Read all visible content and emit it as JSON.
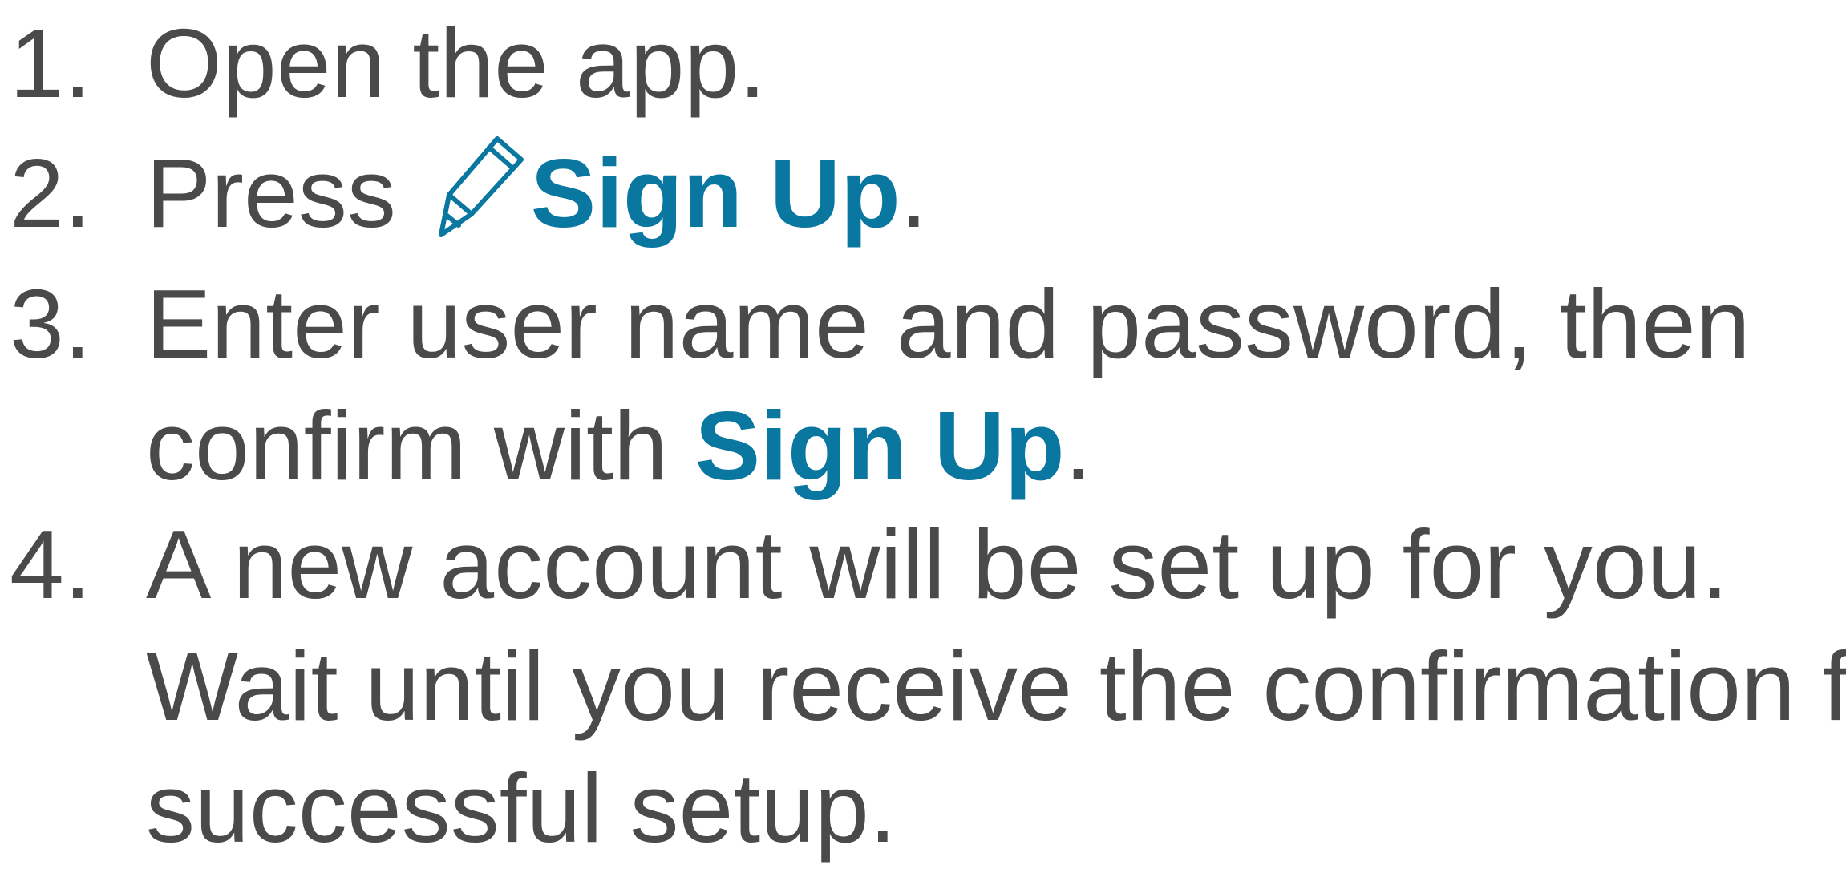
{
  "colors": {
    "text": "#4a4a4a",
    "accent": "#0a77a0",
    "background": "#ffffff"
  },
  "steps": [
    {
      "number": "1.",
      "text": "Open the app."
    },
    {
      "number": "2.",
      "prefix": "Press",
      "icon": "pencil-icon",
      "link": "Sign Up",
      "suffix": "."
    },
    {
      "number": "3.",
      "line1": "Enter user name and password, then",
      "line2_prefix": "confirm with",
      "link": "Sign Up",
      "suffix": "."
    },
    {
      "number": "4.",
      "line1": "A new account will be set up for you.",
      "line2": "Wait until you receive the confirmation for",
      "line3": "successful setup."
    }
  ]
}
